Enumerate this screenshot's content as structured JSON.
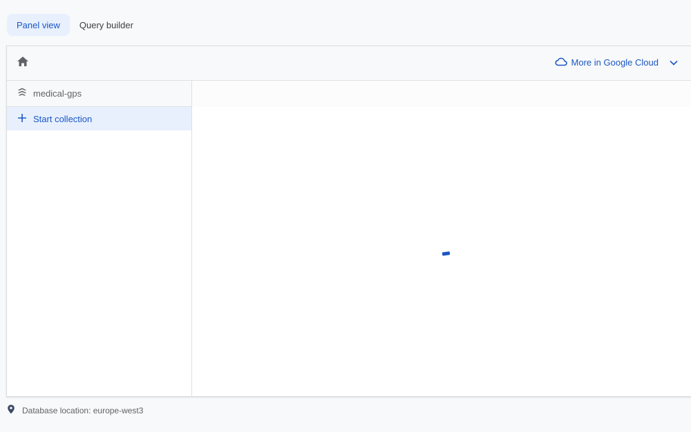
{
  "tabs": [
    {
      "label": "Panel view",
      "active": true
    },
    {
      "label": "Query builder",
      "active": false
    }
  ],
  "header": {
    "home_icon": "home-icon",
    "cloud_link_label": "More in Google Cloud",
    "cloud_icon": "cloud-icon",
    "chevron_icon": "chevron-down-icon"
  },
  "sidebar": {
    "database_name": "medical-gps",
    "database_icon": "database-stack-icon",
    "start_collection_label": "Start collection",
    "start_collection_icon": "plus-icon"
  },
  "main": {
    "loading": true
  },
  "footer": {
    "location_text": "Database location: europe-west3",
    "location_icon": "location-pin-icon"
  },
  "colors": {
    "accent": "#1a56c4",
    "active_tab_bg": "#e8f0fe",
    "page_bg": "#f8f9fa"
  }
}
